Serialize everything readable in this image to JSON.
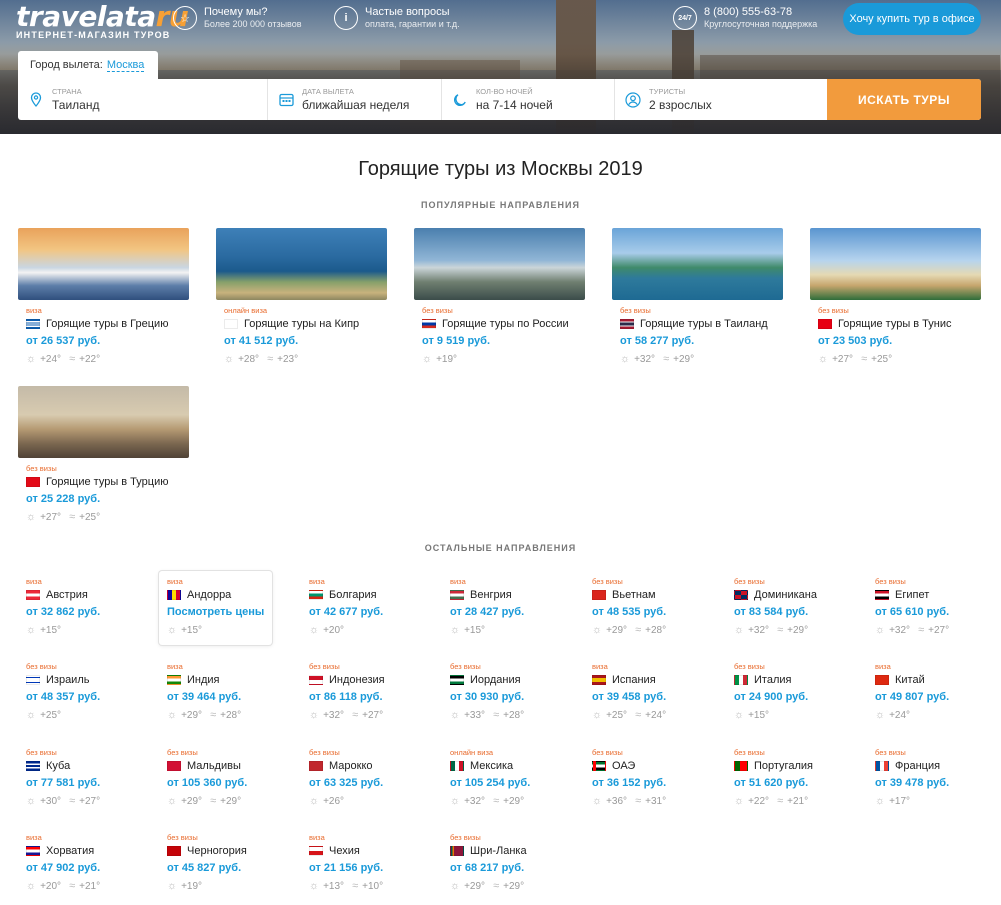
{
  "header": {
    "logo_main": "travelata",
    "logo_ru": "ru",
    "logo_sub": "ИНТЕРНЕТ-МАГАЗИН ТУРОВ",
    "why_title": "Почему мы?",
    "why_sub": "Более 200 000 отзывов",
    "faq_title": "Частые вопросы",
    "faq_sub": "оплата, гарантии и т.д.",
    "support_badge": "24/7",
    "phone": "8 (800) 555-63-78",
    "phone_sub": "Круглосуточная поддержка",
    "office_button": "Хочу купить тур в офисе"
  },
  "search": {
    "city_label": "Город вылета:",
    "city_value": "Москва",
    "country_label": "СТРАНА",
    "country_value": "Таиланд",
    "date_label": "ДАТА ВЫЛЕТА",
    "date_value": "ближайшая неделя",
    "nights_label": "КОЛ-ВО НОЧЕЙ",
    "nights_value": "на 7-14 ночей",
    "tourists_label": "ТУРИСТЫ",
    "tourists_value": "2 взрослых",
    "button": "ИСКАТЬ ТУРЫ"
  },
  "main": {
    "title": "Горящие туры из Москвы 2019",
    "popular_title": "ПОПУЛЯРНЫЕ НАПРАВЛЕНИЯ",
    "other_title": "ОСТАЛЬНЫЕ НАПРАВЛЕНИЯ"
  },
  "popular": [
    {
      "visa": "виза",
      "name": "Горящие туры в Грецию",
      "price": "от 26 537 руб.",
      "air": "+24°",
      "water": "+22°"
    },
    {
      "visa": "онлайн виза",
      "name": "Горящие туры на Кипр",
      "price": "от 41 512 руб.",
      "air": "+28°",
      "water": "+23°"
    },
    {
      "visa": "без визы",
      "name": "Горящие туры по России",
      "price": "от 9 519 руб.",
      "air": "+19°",
      "water": ""
    },
    {
      "visa": "без визы",
      "name": "Горящие туры в Таиланд",
      "price": "от 58 277 руб.",
      "air": "+32°",
      "water": "+29°"
    },
    {
      "visa": "без визы",
      "name": "Горящие туры в Тунис",
      "price": "от 23 503 руб.",
      "air": "+27°",
      "water": "+25°"
    },
    {
      "visa": "без визы",
      "name": "Горящие туры в Турцию",
      "price": "от 25 228 руб.",
      "air": "+27°",
      "water": "+25°"
    }
  ],
  "others": [
    {
      "visa": "виза",
      "name": "Австрия",
      "price": "от 32 862 руб.",
      "air": "+15°",
      "water": ""
    },
    {
      "visa": "виза",
      "name": "Андорра",
      "price": "Посмотреть цены",
      "air": "+15°",
      "water": ""
    },
    {
      "visa": "виза",
      "name": "Болгария",
      "price": "от 42 677 руб.",
      "air": "+20°",
      "water": ""
    },
    {
      "visa": "виза",
      "name": "Венгрия",
      "price": "от 28 427 руб.",
      "air": "+15°",
      "water": ""
    },
    {
      "visa": "без визы",
      "name": "Вьетнам",
      "price": "от 48 535 руб.",
      "air": "+29°",
      "water": "+28°"
    },
    {
      "visa": "без визы",
      "name": "Доминикана",
      "price": "от 83 584 руб.",
      "air": "+32°",
      "water": "+29°"
    },
    {
      "visa": "без визы",
      "name": "Египет",
      "price": "от 65 610 руб.",
      "air": "+32°",
      "water": "+27°"
    },
    {
      "visa": "без визы",
      "name": "Израиль",
      "price": "от 48 357 руб.",
      "air": "+25°",
      "water": ""
    },
    {
      "visa": "виза",
      "name": "Индия",
      "price": "от 39 464 руб.",
      "air": "+29°",
      "water": "+28°"
    },
    {
      "visa": "без визы",
      "name": "Индонезия",
      "price": "от 86 118 руб.",
      "air": "+32°",
      "water": "+27°"
    },
    {
      "visa": "без визы",
      "name": "Иордания",
      "price": "от 30 930 руб.",
      "air": "+33°",
      "water": "+28°"
    },
    {
      "visa": "виза",
      "name": "Испания",
      "price": "от 39 458 руб.",
      "air": "+25°",
      "water": "+24°"
    },
    {
      "visa": "без визы",
      "name": "Италия",
      "price": "от 24 900 руб.",
      "air": "+15°",
      "water": ""
    },
    {
      "visa": "виза",
      "name": "Китай",
      "price": "от 49 807 руб.",
      "air": "+24°",
      "water": ""
    },
    {
      "visa": "без визы",
      "name": "Куба",
      "price": "от 77 581 руб.",
      "air": "+30°",
      "water": "+27°"
    },
    {
      "visa": "без визы",
      "name": "Мальдивы",
      "price": "от 105 360 руб.",
      "air": "+29°",
      "water": "+29°"
    },
    {
      "visa": "без визы",
      "name": "Марокко",
      "price": "от 63 325 руб.",
      "air": "+26°",
      "water": ""
    },
    {
      "visa": "онлайн виза",
      "name": "Мексика",
      "price": "от 105 254 руб.",
      "air": "+32°",
      "water": "+29°"
    },
    {
      "visa": "без визы",
      "name": "ОАЭ",
      "price": "от 36 152 руб.",
      "air": "+36°",
      "water": "+31°"
    },
    {
      "visa": "без визы",
      "name": "Португалия",
      "price": "от 51 620 руб.",
      "air": "+22°",
      "water": "+21°"
    },
    {
      "visa": "без визы",
      "name": "Франция",
      "price": "от 39 478 руб.",
      "air": "+17°",
      "water": ""
    },
    {
      "visa": "виза",
      "name": "Хорватия",
      "price": "от 47 902 руб.",
      "air": "+20°",
      "water": "+21°"
    },
    {
      "visa": "без визы",
      "name": "Черногория",
      "price": "от 45 827 руб.",
      "air": "+19°",
      "water": ""
    },
    {
      "visa": "виза",
      "name": "Чехия",
      "price": "от 21 156 руб.",
      "air": "+13°",
      "water": "+10°"
    },
    {
      "visa": "без визы",
      "name": "Шри-Ланка",
      "price": "от 68 217 руб.",
      "air": "+29°",
      "water": "+29°"
    }
  ],
  "colors": {
    "accent": "#1a9ad9",
    "button": "#f29b3d",
    "visa": "#e86a2c"
  }
}
